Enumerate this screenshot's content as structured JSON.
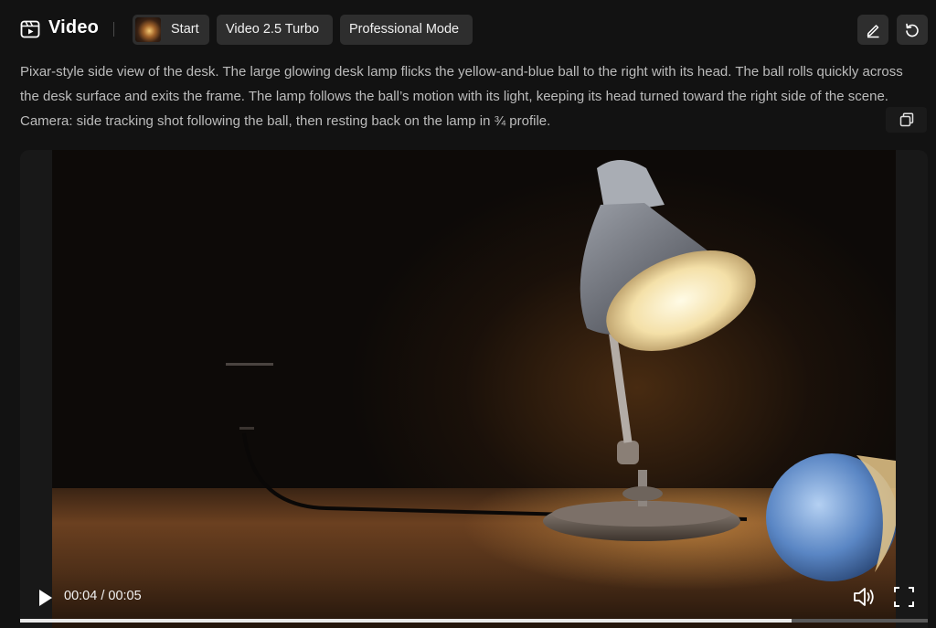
{
  "header": {
    "title": "Video",
    "chips": {
      "start": "Start",
      "model": "Video 2.5 Turbo",
      "mode": "Professional Mode"
    },
    "icons": {
      "title": "video-clip-icon",
      "edit": "pencil-icon",
      "regenerate": "undo-icon"
    }
  },
  "prompt": {
    "text": "Pixar-style side view of the desk. The large glowing desk lamp flicks the yellow-and-blue ball to the right with its head. The ball rolls quickly across the desk surface and exits the frame. The lamp follows the ball’s motion with its light, keeping its head turned toward the right side of the scene. Camera: side tracking shot following the ball, then resting back on the lamp in ¾ profile.",
    "copy_icon": "copy-icon"
  },
  "video": {
    "current_time": "00:04",
    "separator": " / ",
    "duration": "00:05",
    "progress": 0.85,
    "icons": {
      "play": "play-icon",
      "volume": "volume-icon",
      "fullscreen": "fullscreen-icon"
    }
  },
  "colors": {
    "background": "#121212",
    "chip": "#2e2e2e",
    "text": "#bcbcbc",
    "progress": "#e9e9e9"
  }
}
